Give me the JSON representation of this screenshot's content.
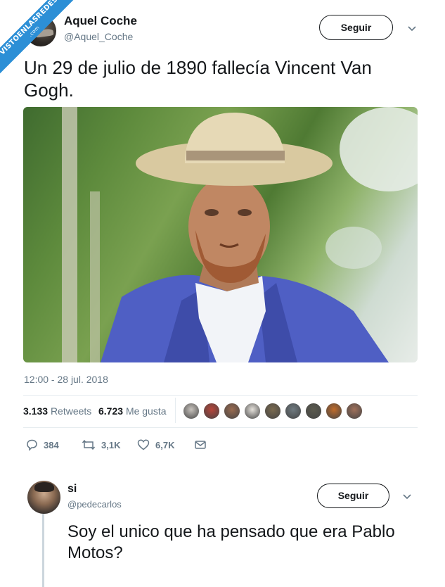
{
  "watermark": {
    "line1": "VISTOENLASREDES",
    "line2": ".com"
  },
  "tweet": {
    "author_name": "Aquel Coche",
    "author_handle": "@Aquel_Coche",
    "follow_label": "Seguir",
    "text": "Un 29 de julio de 1890 fallecía Vincent Van Gogh.",
    "timestamp": "12:00 - 28 jul. 2018",
    "retweets_count": "3.133",
    "retweets_label": "Retweets",
    "likes_count": "6.723",
    "likes_label": "Me gusta",
    "actions": {
      "replies": "384",
      "retweets": "3,1K",
      "likes": "6,7K"
    }
  },
  "reply": {
    "author_name": "si",
    "author_handle": "@pedecarlos",
    "follow_label": "Seguir",
    "text": "Soy el unico que ha pensado que era Pablo Motos?"
  },
  "liker_avatars": [
    "#c8c3bd",
    "#b8453a",
    "#9a6b50",
    "#e6e2dc",
    "#7a6a4f",
    "#6f7a80",
    "#5b5a4e",
    "#c06b2a",
    "#a0705a"
  ],
  "colors": {
    "brand_blue": "#2c8fd6",
    "muted": "#657786",
    "divider": "#e6ecf0"
  }
}
